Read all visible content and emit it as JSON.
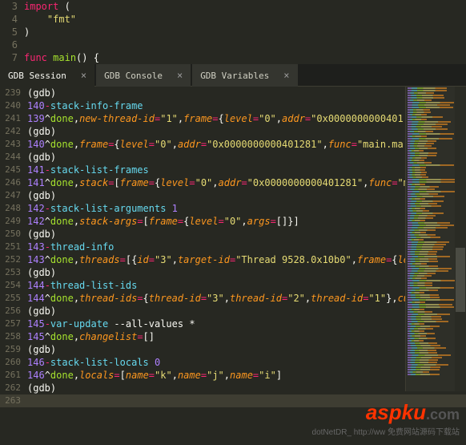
{
  "editor": {
    "lines": [
      {
        "num": "3",
        "tokens": [
          {
            "t": "kw-red",
            "v": "import"
          },
          {
            "t": "punc",
            "v": " ("
          }
        ]
      },
      {
        "num": "4",
        "tokens": [
          {
            "t": "punc",
            "v": "    "
          },
          {
            "t": "str",
            "v": "\"fmt\""
          }
        ]
      },
      {
        "num": "5",
        "tokens": [
          {
            "t": "punc",
            "v": ")"
          }
        ]
      },
      {
        "num": "6",
        "tokens": []
      },
      {
        "num": "7",
        "tokens": [
          {
            "t": "kw-red",
            "v": "func"
          },
          {
            "t": "punc",
            "v": " "
          },
          {
            "t": "name-green",
            "v": "main"
          },
          {
            "t": "punc",
            "v": "() {"
          }
        ]
      }
    ]
  },
  "tabs": [
    {
      "label": "GDB Session",
      "active": true
    },
    {
      "label": "GDB Console",
      "active": false
    },
    {
      "label": "GDB Variables",
      "active": false
    }
  ],
  "session": [
    {
      "num": "239",
      "tokens": [
        {
          "t": "gdb-punc",
          "v": "(gdb)"
        }
      ]
    },
    {
      "num": "240",
      "tokens": [
        {
          "t": "gdb-num",
          "v": "140"
        },
        {
          "t": "gdb-dash",
          "v": "-"
        },
        {
          "t": "gdb-cmd",
          "v": "stack-info-frame"
        }
      ]
    },
    {
      "num": "241",
      "tokens": [
        {
          "t": "gdb-num",
          "v": "139"
        },
        {
          "t": "gdb-caret",
          "v": "^"
        },
        {
          "t": "gdb-done",
          "v": "done"
        },
        {
          "t": "gdb-punc",
          "v": ","
        },
        {
          "t": "gdb-field",
          "v": "new-thread-id"
        },
        {
          "t": "gdb-eq",
          "v": "="
        },
        {
          "t": "gdb-str",
          "v": "\"1\""
        },
        {
          "t": "gdb-punc",
          "v": ","
        },
        {
          "t": "gdb-field",
          "v": "frame"
        },
        {
          "t": "gdb-eq",
          "v": "="
        },
        {
          "t": "gdb-punc",
          "v": "{"
        },
        {
          "t": "gdb-field",
          "v": "level"
        },
        {
          "t": "gdb-eq",
          "v": "="
        },
        {
          "t": "gdb-str",
          "v": "\"0\""
        },
        {
          "t": "gdb-punc",
          "v": ","
        },
        {
          "t": "gdb-field",
          "v": "addr"
        },
        {
          "t": "gdb-eq",
          "v": "="
        },
        {
          "t": "gdb-str",
          "v": "\"0x0000000000401"
        }
      ]
    },
    {
      "num": "242",
      "tokens": [
        {
          "t": "gdb-punc",
          "v": "(gdb)"
        }
      ]
    },
    {
      "num": "243",
      "tokens": [
        {
          "t": "gdb-num",
          "v": "140"
        },
        {
          "t": "gdb-caret",
          "v": "^"
        },
        {
          "t": "gdb-done",
          "v": "done"
        },
        {
          "t": "gdb-punc",
          "v": ","
        },
        {
          "t": "gdb-field",
          "v": "frame"
        },
        {
          "t": "gdb-eq",
          "v": "="
        },
        {
          "t": "gdb-punc",
          "v": "{"
        },
        {
          "t": "gdb-field",
          "v": "level"
        },
        {
          "t": "gdb-eq",
          "v": "="
        },
        {
          "t": "gdb-str",
          "v": "\"0\""
        },
        {
          "t": "gdb-punc",
          "v": ","
        },
        {
          "t": "gdb-field",
          "v": "addr"
        },
        {
          "t": "gdb-eq",
          "v": "="
        },
        {
          "t": "gdb-str",
          "v": "\"0x0000000000401281\""
        },
        {
          "t": "gdb-punc",
          "v": ","
        },
        {
          "t": "gdb-field",
          "v": "func"
        },
        {
          "t": "gdb-eq",
          "v": "="
        },
        {
          "t": "gdb-str",
          "v": "\"main.ma"
        }
      ]
    },
    {
      "num": "244",
      "tokens": [
        {
          "t": "gdb-punc",
          "v": "(gdb)"
        }
      ]
    },
    {
      "num": "245",
      "tokens": [
        {
          "t": "gdb-num",
          "v": "141"
        },
        {
          "t": "gdb-dash",
          "v": "-"
        },
        {
          "t": "gdb-cmd",
          "v": "stack-list-frames"
        }
      ]
    },
    {
      "num": "246",
      "tokens": [
        {
          "t": "gdb-num",
          "v": "141"
        },
        {
          "t": "gdb-caret",
          "v": "^"
        },
        {
          "t": "gdb-done",
          "v": "done"
        },
        {
          "t": "gdb-punc",
          "v": ","
        },
        {
          "t": "gdb-field",
          "v": "stack"
        },
        {
          "t": "gdb-eq",
          "v": "="
        },
        {
          "t": "gdb-punc",
          "v": "["
        },
        {
          "t": "gdb-field",
          "v": "frame"
        },
        {
          "t": "gdb-eq",
          "v": "="
        },
        {
          "t": "gdb-punc",
          "v": "{"
        },
        {
          "t": "gdb-field",
          "v": "level"
        },
        {
          "t": "gdb-eq",
          "v": "="
        },
        {
          "t": "gdb-str",
          "v": "\"0\""
        },
        {
          "t": "gdb-punc",
          "v": ","
        },
        {
          "t": "gdb-field",
          "v": "addr"
        },
        {
          "t": "gdb-eq",
          "v": "="
        },
        {
          "t": "gdb-str",
          "v": "\"0x0000000000401281\""
        },
        {
          "t": "gdb-punc",
          "v": ","
        },
        {
          "t": "gdb-field",
          "v": "func"
        },
        {
          "t": "gdb-eq",
          "v": "="
        },
        {
          "t": "gdb-str",
          "v": "\"m"
        }
      ]
    },
    {
      "num": "247",
      "tokens": [
        {
          "t": "gdb-punc",
          "v": "(gdb)"
        }
      ]
    },
    {
      "num": "248",
      "tokens": [
        {
          "t": "gdb-num",
          "v": "142"
        },
        {
          "t": "gdb-dash",
          "v": "-"
        },
        {
          "t": "gdb-cmd",
          "v": "stack-list-arguments"
        },
        {
          "t": "gdb-punc",
          "v": " "
        },
        {
          "t": "gdb-num",
          "v": "1"
        }
      ]
    },
    {
      "num": "249",
      "tokens": [
        {
          "t": "gdb-num",
          "v": "142"
        },
        {
          "t": "gdb-caret",
          "v": "^"
        },
        {
          "t": "gdb-done",
          "v": "done"
        },
        {
          "t": "gdb-punc",
          "v": ","
        },
        {
          "t": "gdb-field",
          "v": "stack-args"
        },
        {
          "t": "gdb-eq",
          "v": "="
        },
        {
          "t": "gdb-punc",
          "v": "["
        },
        {
          "t": "gdb-field",
          "v": "frame"
        },
        {
          "t": "gdb-eq",
          "v": "="
        },
        {
          "t": "gdb-punc",
          "v": "{"
        },
        {
          "t": "gdb-field",
          "v": "level"
        },
        {
          "t": "gdb-eq",
          "v": "="
        },
        {
          "t": "gdb-str",
          "v": "\"0\""
        },
        {
          "t": "gdb-punc",
          "v": ","
        },
        {
          "t": "gdb-field",
          "v": "args"
        },
        {
          "t": "gdb-eq",
          "v": "="
        },
        {
          "t": "gdb-punc",
          "v": "[]}]"
        }
      ]
    },
    {
      "num": "250",
      "tokens": [
        {
          "t": "gdb-punc",
          "v": "(gdb)"
        }
      ]
    },
    {
      "num": "251",
      "tokens": [
        {
          "t": "gdb-num",
          "v": "143"
        },
        {
          "t": "gdb-dash",
          "v": "-"
        },
        {
          "t": "gdb-cmd",
          "v": "thread-info"
        }
      ]
    },
    {
      "num": "252",
      "tokens": [
        {
          "t": "gdb-num",
          "v": "143"
        },
        {
          "t": "gdb-caret",
          "v": "^"
        },
        {
          "t": "gdb-done",
          "v": "done"
        },
        {
          "t": "gdb-punc",
          "v": ","
        },
        {
          "t": "gdb-field",
          "v": "threads"
        },
        {
          "t": "gdb-eq",
          "v": "="
        },
        {
          "t": "gdb-punc",
          "v": "[{"
        },
        {
          "t": "gdb-field",
          "v": "id"
        },
        {
          "t": "gdb-eq",
          "v": "="
        },
        {
          "t": "gdb-str",
          "v": "\"3\""
        },
        {
          "t": "gdb-punc",
          "v": ","
        },
        {
          "t": "gdb-field",
          "v": "target-id"
        },
        {
          "t": "gdb-eq",
          "v": "="
        },
        {
          "t": "gdb-str",
          "v": "\"Thread 9528.0x10b0\""
        },
        {
          "t": "gdb-punc",
          "v": ","
        },
        {
          "t": "gdb-field",
          "v": "frame"
        },
        {
          "t": "gdb-eq",
          "v": "="
        },
        {
          "t": "gdb-punc",
          "v": "{"
        },
        {
          "t": "gdb-field",
          "v": "le"
        }
      ]
    },
    {
      "num": "253",
      "tokens": [
        {
          "t": "gdb-punc",
          "v": "(gdb)"
        }
      ]
    },
    {
      "num": "254",
      "tokens": [
        {
          "t": "gdb-num",
          "v": "144"
        },
        {
          "t": "gdb-dash",
          "v": "-"
        },
        {
          "t": "gdb-cmd",
          "v": "thread-list-ids"
        }
      ]
    },
    {
      "num": "255",
      "tokens": [
        {
          "t": "gdb-num",
          "v": "144"
        },
        {
          "t": "gdb-caret",
          "v": "^"
        },
        {
          "t": "gdb-done",
          "v": "done"
        },
        {
          "t": "gdb-punc",
          "v": ","
        },
        {
          "t": "gdb-field",
          "v": "thread-ids"
        },
        {
          "t": "gdb-eq",
          "v": "="
        },
        {
          "t": "gdb-punc",
          "v": "{"
        },
        {
          "t": "gdb-field",
          "v": "thread-id"
        },
        {
          "t": "gdb-eq",
          "v": "="
        },
        {
          "t": "gdb-str",
          "v": "\"3\""
        },
        {
          "t": "gdb-punc",
          "v": ","
        },
        {
          "t": "gdb-field",
          "v": "thread-id"
        },
        {
          "t": "gdb-eq",
          "v": "="
        },
        {
          "t": "gdb-str",
          "v": "\"2\""
        },
        {
          "t": "gdb-punc",
          "v": ","
        },
        {
          "t": "gdb-field",
          "v": "thread-id"
        },
        {
          "t": "gdb-eq",
          "v": "="
        },
        {
          "t": "gdb-str",
          "v": "\"1\""
        },
        {
          "t": "gdb-punc",
          "v": "},"
        },
        {
          "t": "gdb-field",
          "v": "cu"
        }
      ]
    },
    {
      "num": "256",
      "tokens": [
        {
          "t": "gdb-punc",
          "v": "(gdb)"
        }
      ]
    },
    {
      "num": "257",
      "tokens": [
        {
          "t": "gdb-num",
          "v": "145"
        },
        {
          "t": "gdb-dash",
          "v": "-"
        },
        {
          "t": "gdb-cmd",
          "v": "var-update"
        },
        {
          "t": "gdb-punc",
          "v": " --all-values *"
        }
      ]
    },
    {
      "num": "258",
      "tokens": [
        {
          "t": "gdb-num",
          "v": "145"
        },
        {
          "t": "gdb-caret",
          "v": "^"
        },
        {
          "t": "gdb-done",
          "v": "done"
        },
        {
          "t": "gdb-punc",
          "v": ","
        },
        {
          "t": "gdb-field",
          "v": "changelist"
        },
        {
          "t": "gdb-eq",
          "v": "="
        },
        {
          "t": "gdb-punc",
          "v": "[]"
        }
      ]
    },
    {
      "num": "259",
      "tokens": [
        {
          "t": "gdb-punc",
          "v": "(gdb)"
        }
      ]
    },
    {
      "num": "260",
      "tokens": [
        {
          "t": "gdb-num",
          "v": "146"
        },
        {
          "t": "gdb-dash",
          "v": "-"
        },
        {
          "t": "gdb-cmd",
          "v": "stack-list-locals"
        },
        {
          "t": "gdb-punc",
          "v": " "
        },
        {
          "t": "gdb-num",
          "v": "0"
        }
      ]
    },
    {
      "num": "261",
      "tokens": [
        {
          "t": "gdb-num",
          "v": "146"
        },
        {
          "t": "gdb-caret",
          "v": "^"
        },
        {
          "t": "gdb-done",
          "v": "done"
        },
        {
          "t": "gdb-punc",
          "v": ","
        },
        {
          "t": "gdb-field",
          "v": "locals"
        },
        {
          "t": "gdb-eq",
          "v": "="
        },
        {
          "t": "gdb-punc",
          "v": "["
        },
        {
          "t": "gdb-field",
          "v": "name"
        },
        {
          "t": "gdb-eq",
          "v": "="
        },
        {
          "t": "gdb-str",
          "v": "\"k\""
        },
        {
          "t": "gdb-punc",
          "v": ","
        },
        {
          "t": "gdb-field",
          "v": "name"
        },
        {
          "t": "gdb-eq",
          "v": "="
        },
        {
          "t": "gdb-str",
          "v": "\"j\""
        },
        {
          "t": "gdb-punc",
          "v": ","
        },
        {
          "t": "gdb-field",
          "v": "name"
        },
        {
          "t": "gdb-eq",
          "v": "="
        },
        {
          "t": "gdb-str",
          "v": "\"i\""
        },
        {
          "t": "gdb-punc",
          "v": "]"
        }
      ]
    },
    {
      "num": "262",
      "tokens": [
        {
          "t": "gdb-punc",
          "v": "(gdb)"
        }
      ]
    },
    {
      "num": "263",
      "tokens": [],
      "active": true
    }
  ],
  "watermark": {
    "brand": "aspku",
    "tld": ".com",
    "sub": "dotNetDR_ http://ww   免费网站源码下载站"
  }
}
